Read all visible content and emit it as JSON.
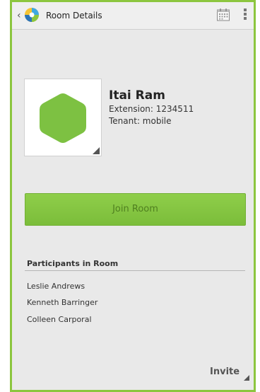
{
  "actionbar": {
    "back_icon": "chevron-left-icon",
    "logo_icon": "app-logo-icon",
    "title": "Room Details",
    "calendar_icon": "calendar-icon",
    "overflow_icon": "overflow-menu-icon"
  },
  "profile": {
    "name": "Itai Ram",
    "extension": "Extension: 1234511",
    "tenant": "Tenant: mobile",
    "avatar_icon": "hexagon-avatar-icon"
  },
  "join_button": {
    "label": "Join Room"
  },
  "participants": {
    "header": "Participants in Room",
    "items": [
      "Leslie Andrews",
      "Kenneth Barringer",
      "Colleen Carporal"
    ]
  },
  "invite": {
    "label": "Invite"
  },
  "colors": {
    "accent": "#8cc63f",
    "avatar_hex": "#7dc142",
    "join_button": "#85c641",
    "background": "#e9e9e9"
  }
}
